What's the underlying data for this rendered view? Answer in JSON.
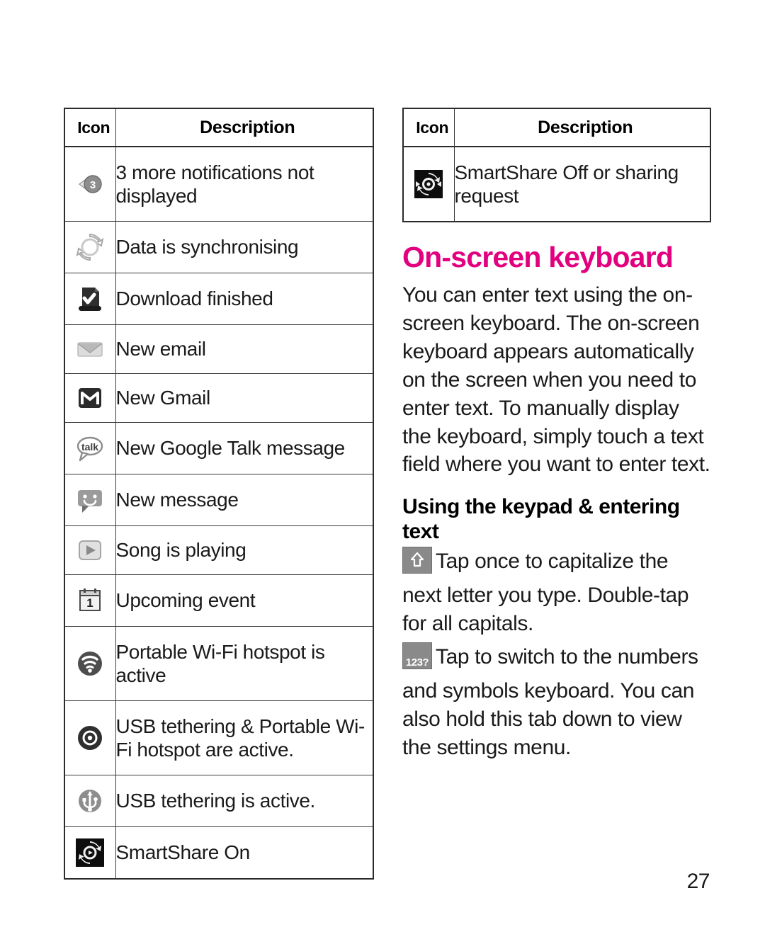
{
  "page": {
    "number": "27"
  },
  "left_table": {
    "headers": {
      "icon": "Icon",
      "description": "Description"
    },
    "rows": [
      {
        "icon": "notifications-more-icon",
        "description": "3 more notifications not displayed",
        "size": "tall"
      },
      {
        "icon": "sync-icon",
        "description": "Data is synchronising",
        "size": "med"
      },
      {
        "icon": "download-finished-icon",
        "description": "Download finished",
        "size": "med"
      },
      {
        "icon": "new-email-icon",
        "description": "New email",
        "size": "sm"
      },
      {
        "icon": "new-gmail-icon",
        "description": "New Gmail",
        "size": "sm"
      },
      {
        "icon": "google-talk-icon",
        "description": "New Google Talk message",
        "size": "med"
      },
      {
        "icon": "new-message-icon",
        "description": "New message",
        "size": "med"
      },
      {
        "icon": "song-playing-icon",
        "description": "Song is playing",
        "size": "sm"
      },
      {
        "icon": "upcoming-event-icon",
        "description": "Upcoming event",
        "size": "med"
      },
      {
        "icon": "wifi-hotspot-icon",
        "description": "Portable Wi-Fi hotspot is active",
        "size": "tall"
      },
      {
        "icon": "usb-tether-hotspot-icon",
        "description": "USB tethering & Portable Wi-Fi hotspot are active.",
        "size": "tall"
      },
      {
        "icon": "usb-tethering-icon",
        "description": "USB tethering is active.",
        "size": "med"
      },
      {
        "icon": "smartshare-on-icon",
        "description": "SmartShare On",
        "size": "med"
      }
    ]
  },
  "right_table": {
    "headers": {
      "icon": "Icon",
      "description": "Description"
    },
    "rows": [
      {
        "icon": "smartshare-off-icon",
        "description": "SmartShare Off or sharing request",
        "size": "tall"
      }
    ]
  },
  "right_column": {
    "heading": "On-screen keyboard",
    "intro_paragraph": "You can enter text using the on-screen keyboard. The on-screen keyboard appears automatically on the screen when you need to enter text. To manually display the keyboard, simply touch a text field where you want to enter text.",
    "subheading": "Using the keypad & entering text",
    "shift_paragraph": "Tap once to capitalize the next letter you type. Double-tap for all capitals.",
    "symbols_key_label": "123?",
    "symbols_paragraph": "Tap to switch to the numbers and symbols keyboard. You can also hold this tab down to view the settings menu."
  },
  "colors": {
    "heading_pink": "#e2007f",
    "table_border": "#2b2b2b",
    "body_text": "#1a1a1a"
  }
}
